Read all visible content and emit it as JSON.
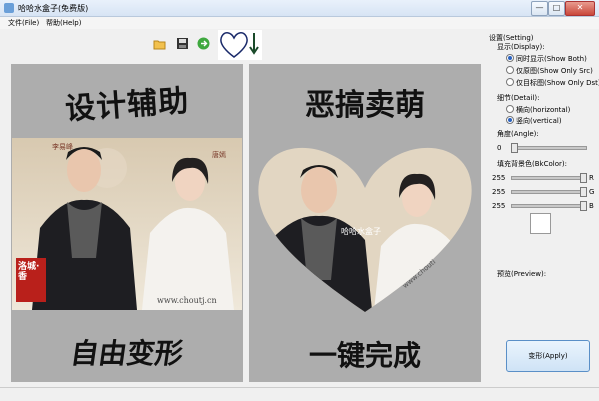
{
  "window": {
    "title": "哈哈水盒子(免费版)",
    "minimize": "—",
    "maximize": "□",
    "close": "✕"
  },
  "menu": {
    "file": "文件(File)",
    "help": "帮助(Help)"
  },
  "toolbar": {
    "open_icon": "folder-open-icon",
    "save_icon": "save-icon",
    "run_icon": "go-icon",
    "preview_icon": "heart-arrow-icon"
  },
  "left": {
    "top_caption": "设计辅助",
    "bottom_caption": "自由变形",
    "watermark": "www.choutj.cn",
    "badge": "洛城·香",
    "name_left": "李易峰",
    "name_right": "唐嫣"
  },
  "middle": {
    "top_caption": "恶搞卖萌",
    "bottom_caption": "一键完成",
    "overlay": "哈哈水盒子",
    "watermark": "www.chouti"
  },
  "settings": {
    "group": "设置(Setting)",
    "display_label": "显示(Display):",
    "display_options": [
      "同时显示(Show Both)",
      "仅原图(Show Only Src)",
      "仅目标图(Show Only Dst)"
    ],
    "display_selected": 0,
    "detail_label": "细节(Detail):",
    "detail_options": [
      "横向(horizontal)",
      "竖向(vertical)"
    ],
    "detail_selected": 1,
    "angle_label": "角度(Angle):",
    "angle_value": "0",
    "angle_fraction": 0,
    "bg_label": "填充背景色(BkColor):",
    "rgb": [
      {
        "value": "255",
        "channel": "R",
        "fraction": 1
      },
      {
        "value": "255",
        "channel": "G",
        "fraction": 1
      },
      {
        "value": "255",
        "channel": "B",
        "fraction": 1
      }
    ],
    "preview_label": "预览(Preview):",
    "apply_label": "变形(Apply)"
  },
  "colors": {
    "accent": "#2a62c0",
    "panel_bg": "#adadad",
    "heart_stroke": "#1a2a6a"
  }
}
